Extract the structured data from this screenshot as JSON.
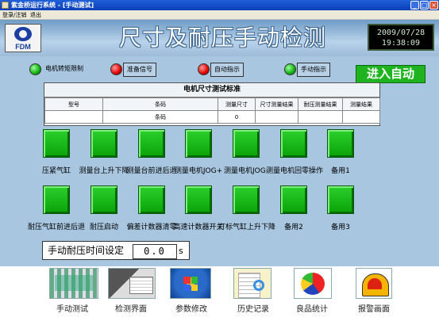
{
  "window": {
    "title": "紫金桥运行系统 - [手动测试]"
  },
  "menu": {
    "items": [
      "登录/注销",
      "退出"
    ]
  },
  "header": {
    "logo_text": "FDM",
    "title": "尺寸及耐压手动检测",
    "date": "2009/07/28",
    "time": "19:38:09"
  },
  "indicators": [
    {
      "label": "电机转矩限制",
      "color": "green"
    },
    {
      "label": "准备信号",
      "color": "red"
    },
    {
      "label": "自动指示",
      "color": "red"
    },
    {
      "label": "手动指示",
      "color": "green"
    }
  ],
  "auto_button": "进入自动",
  "standard_table": {
    "caption": "电机尺寸测试标准",
    "columns": [
      "型号",
      "条码",
      "测量尺寸",
      "尺寸测量结果",
      "耐压测量结果",
      "测量结果"
    ],
    "row": [
      "",
      "条码",
      "0",
      "",
      "",
      ""
    ]
  },
  "controls_row1": [
    "压紧气缸",
    "测量台上升下降",
    "测量台前进后退",
    "测量电机JOG+",
    "测量电机JOG-",
    "测量电机回零操作",
    "备用1"
  ],
  "controls_row2": [
    "耐压气缸前进后退",
    "耐压启动",
    "偏差计数器清零",
    "高速计数器开关",
    "打标气缸上升下降",
    "备用2",
    "备用3"
  ],
  "time_setting": {
    "label": "手动耐压时间设定",
    "value": "0.0",
    "unit": "s"
  },
  "nav": [
    {
      "label": "手动测试",
      "icon": "manual-test-icon"
    },
    {
      "label": "检测界面",
      "icon": "inspection-icon"
    },
    {
      "label": "参数修改",
      "icon": "parameter-icon"
    },
    {
      "label": "历史记录",
      "icon": "history-icon"
    },
    {
      "label": "良品统计",
      "icon": "statistics-icon"
    },
    {
      "label": "报警画面",
      "icon": "alarm-icon"
    }
  ]
}
